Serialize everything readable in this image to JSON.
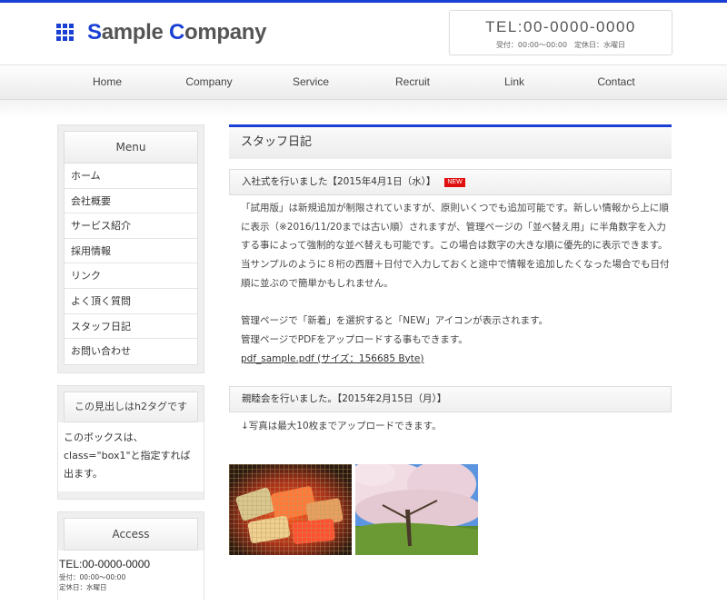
{
  "header": {
    "logo_first": "S",
    "logo_mid": "ample ",
    "logo_first2": "C",
    "logo_rest": "ompany",
    "tel": "TEL:00-0000-0000",
    "hours": "受付：00:00〜00:00　定休日：水曜日"
  },
  "nav": {
    "items": [
      {
        "label": "Home"
      },
      {
        "label": "Company"
      },
      {
        "label": "Service"
      },
      {
        "label": "Recruit"
      },
      {
        "label": "Link"
      },
      {
        "label": "Contact"
      }
    ]
  },
  "sidebar": {
    "menu_title": "Menu",
    "menu_items": [
      {
        "label": "ホーム"
      },
      {
        "label": "会社概要"
      },
      {
        "label": "サービス紹介"
      },
      {
        "label": "採用情報"
      },
      {
        "label": "リンク"
      },
      {
        "label": "よく頂く質問"
      },
      {
        "label": "スタッフ日記"
      },
      {
        "label": "お問い合わせ"
      }
    ],
    "h2_title": "この見出しはh2タグです",
    "h2_text": "このボックスは、class=\"box1\"と指定すれば出ます。",
    "access_title": "Access",
    "access_tel": "TEL:00-0000-0000",
    "access_hours": "受付：00:00〜00:00",
    "access_closed": "定休日：水曜日"
  },
  "main": {
    "title": "スタッフ日記",
    "post1": {
      "heading": "入社式を行いました【2015年4月1日（水）】",
      "badge": "NEW",
      "para1": "「試用版」は新規追加が制限されていますが、原則いくつでも追加可能です。新しい情報から上に順に表示（※2016/11/20までは古い順）されますが、管理ページの「並べ替え用」に半角数字を入力する事によって強制的な並べ替えも可能です。この場合は数字の大きな順に優先的に表示できます。当サンプルのように８桁の西暦＋日付で入力しておくと途中で情報を追加したくなった場合でも日付順に並ぶので簡単かもしれません。",
      "para2": "管理ページで「新着」を選択すると「NEW」アイコンが表示されます。",
      "para3": "管理ページでPDFをアップロードする事もできます。",
      "pdf_link": "pdf_sample.pdf (サイズ：156685 Byte)"
    },
    "post2": {
      "heading": "親睦会を行いました。【2015年2月15日（月）】",
      "text": "↓写真は最大10枚までアップロードできます。"
    }
  },
  "colors": {
    "accent": "#1a3fd4",
    "badge": "#e01010"
  }
}
